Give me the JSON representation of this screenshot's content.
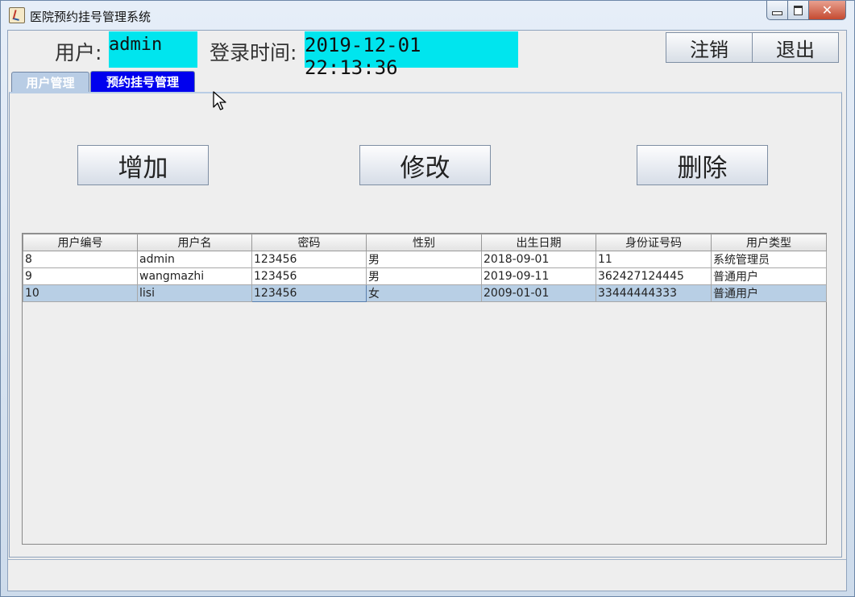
{
  "window": {
    "title": "医院预约挂号管理系统"
  },
  "header": {
    "user_label": "用户:",
    "user_value": "admin",
    "login_label": "登录时间:",
    "login_value": "2019-12-01 22:13:36",
    "logout_label": "注销",
    "exit_label": "退出"
  },
  "tabs": [
    {
      "label": "用户管理",
      "selected": true
    },
    {
      "label": "预约挂号管理",
      "selected": false
    }
  ],
  "actions": {
    "add_label": "增加",
    "edit_label": "修改",
    "delete_label": "删除"
  },
  "table": {
    "columns": [
      "用户编号",
      "用户名",
      "密码",
      "性别",
      "出生日期",
      "身份证号码",
      "用户类型"
    ],
    "rows": [
      [
        "8",
        "admin",
        "123456",
        "男",
        "2018-09-01",
        "11",
        "系统管理员"
      ],
      [
        "9",
        "wangmazhi",
        "123456",
        "男",
        "2019-09-11",
        "362427124445",
        "普通用户"
      ],
      [
        "10",
        "lisi",
        "123456",
        "女",
        "2009-01-01",
        "33444444333",
        "普通用户"
      ]
    ],
    "selected_row": 2
  },
  "colors": {
    "highlight": "#00e5ee",
    "tab_active_blue": "#0000ee",
    "selection": "#b8cfe5"
  },
  "icons": [
    "java-app-icon",
    "minimize-icon",
    "maximize-icon",
    "close-icon",
    "mouse-cursor-icon"
  ]
}
